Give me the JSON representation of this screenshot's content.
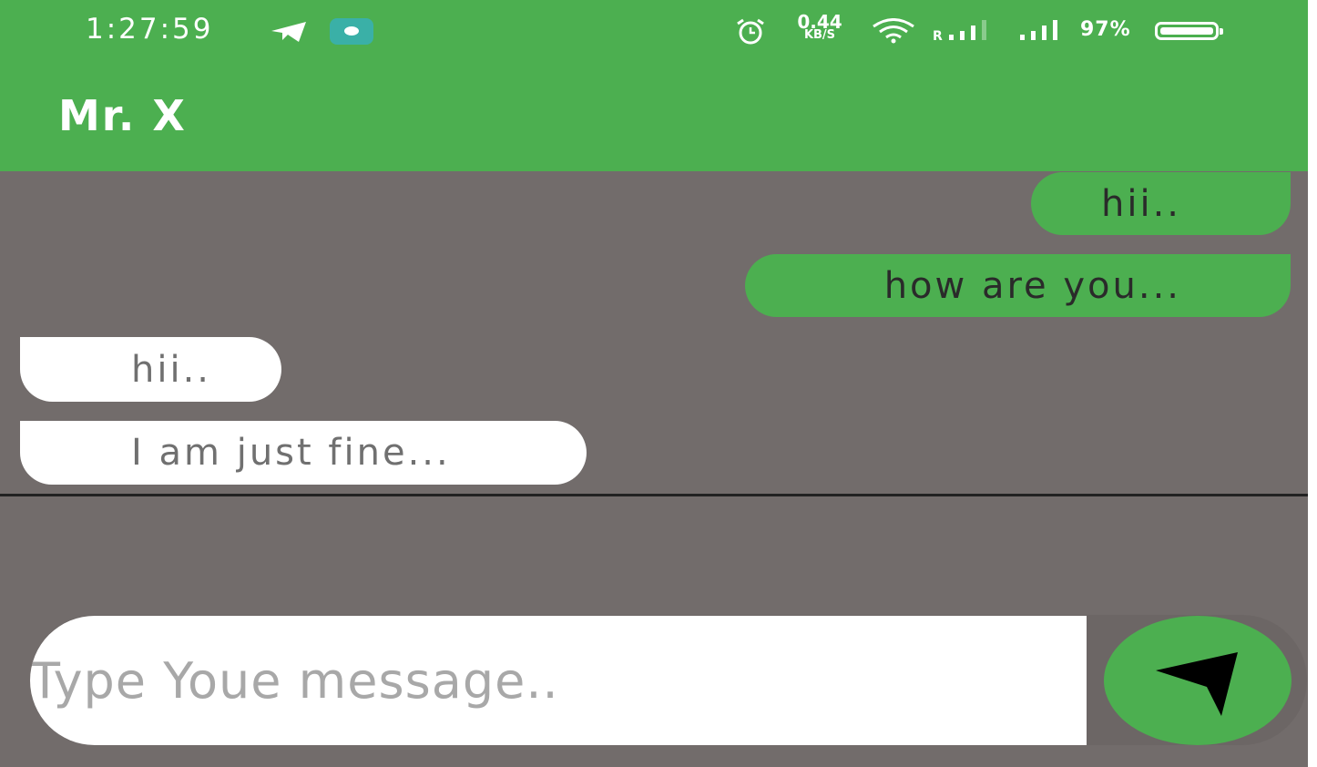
{
  "status_bar": {
    "time": "1:27:59",
    "net_speed_value": "0.44",
    "net_speed_unit": "KB/S",
    "signal_label": "R",
    "battery_percent": "97%"
  },
  "header": {
    "title": "Mr. X"
  },
  "messages": [
    {
      "direction": "sent",
      "text": "hii.."
    },
    {
      "direction": "sent",
      "text": "how are you..."
    },
    {
      "direction": "received",
      "text": "hii.."
    },
    {
      "direction": "received",
      "text": "I am just fine..."
    }
  ],
  "composer": {
    "placeholder": "Type Youe message..",
    "value": ""
  },
  "colors": {
    "accent": "#4caf50",
    "background": "#726c6b",
    "received_bubble": "#ffffff"
  },
  "icons": {
    "telegram": "telegram-icon",
    "app_badge": "app-badge-icon",
    "alarm": "alarm-icon",
    "wifi": "wifi-icon",
    "signal": "signal-icon",
    "battery": "battery-icon",
    "send": "send-icon"
  }
}
